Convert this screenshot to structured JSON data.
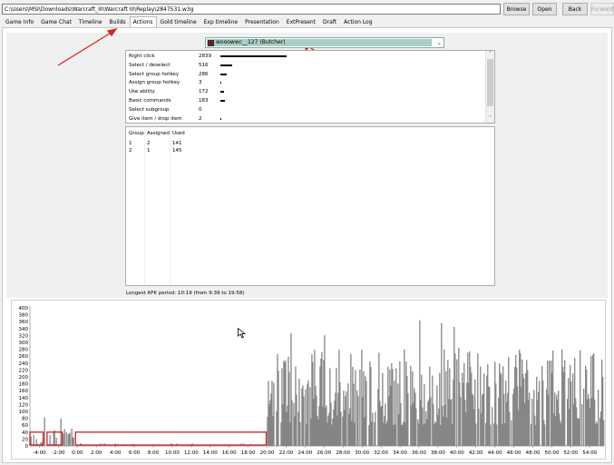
{
  "toolbar": {
    "path_value": "C:\\Users\\MSI\\Downloads\\Warcraft_III\\Warcraft III\\Replay\\2847531.w3g",
    "browse_label": "Browse",
    "open_label": "Open",
    "back_label": "Back",
    "forward_label": "Forward"
  },
  "tabs": [
    {
      "label": "Game Info"
    },
    {
      "label": "Game Chat"
    },
    {
      "label": "Timeline"
    },
    {
      "label": "Builds"
    },
    {
      "label": "Actions"
    },
    {
      "label": "Gold timeline"
    },
    {
      "label": "Exp timeline"
    },
    {
      "label": "Presentation"
    },
    {
      "label": "ExtPresent"
    },
    {
      "label": "Draft"
    },
    {
      "label": "Action Log"
    }
  ],
  "active_tab": "Actions",
  "player": {
    "selected": "wooowwc__127 (Butcher)",
    "highlight_color": "#a7cfc3"
  },
  "actions": [
    {
      "label": "Right click",
      "value": "2839",
      "share": 1.0
    },
    {
      "label": "Select / deselect",
      "value": "516",
      "share": 0.182
    },
    {
      "label": "Select group hotkey",
      "value": "286",
      "share": 0.101
    },
    {
      "label": "Assign group hotkey",
      "value": "3",
      "share": 0.001
    },
    {
      "label": "Use ability",
      "value": "172",
      "share": 0.061
    },
    {
      "label": "Basic commands",
      "value": "183",
      "share": 0.064
    },
    {
      "label": "Select subgroup",
      "value": "0",
      "share": 0.0
    },
    {
      "label": "Give item / drop item",
      "value": "2",
      "share": 0.001
    }
  ],
  "groups": {
    "headers": [
      "Group",
      "Assigned",
      "Used"
    ],
    "rows": [
      [
        "1",
        "2",
        "141"
      ],
      [
        "2",
        "1",
        "145"
      ]
    ]
  },
  "afk_text": "Longest AFK period: 10:19 (from 9:39 to 19:58)",
  "chart_data": {
    "type": "bar",
    "xlabel": "",
    "ylabel": "",
    "ylim": [
      0,
      400
    ],
    "y_ticks": [
      "0",
      "20",
      "40",
      "60",
      "80",
      "100",
      "120",
      "140",
      "160",
      "180",
      "200",
      "220",
      "240",
      "260",
      "280",
      "300",
      "320",
      "340",
      "360",
      "380",
      "400"
    ],
    "x_ticks": [
      "-4:00",
      "-2:00",
      "0:00",
      "2:00",
      "4:00",
      "6:00",
      "8:00",
      "10:00",
      "12:00",
      "14:00",
      "16:00",
      "18:00",
      "20:00",
      "22:00",
      "24:00",
      "26:00",
      "28:00",
      "30:00",
      "32:00",
      "34:00",
      "36:00",
      "38:00",
      "40:00",
      "42:00",
      "44:00",
      "46:00",
      "48:00",
      "50:00",
      "52:00",
      "54:00"
    ],
    "x_range_minutes": [
      -5,
      55.5
    ],
    "bar_color": "#858585",
    "highlight_color": "#cc1f1f",
    "highlight_boxes_minutes": [
      [
        -5,
        -3.6
      ],
      [
        -3.2,
        -1.6
      ],
      [
        -0.2,
        19.9
      ]
    ]
  }
}
